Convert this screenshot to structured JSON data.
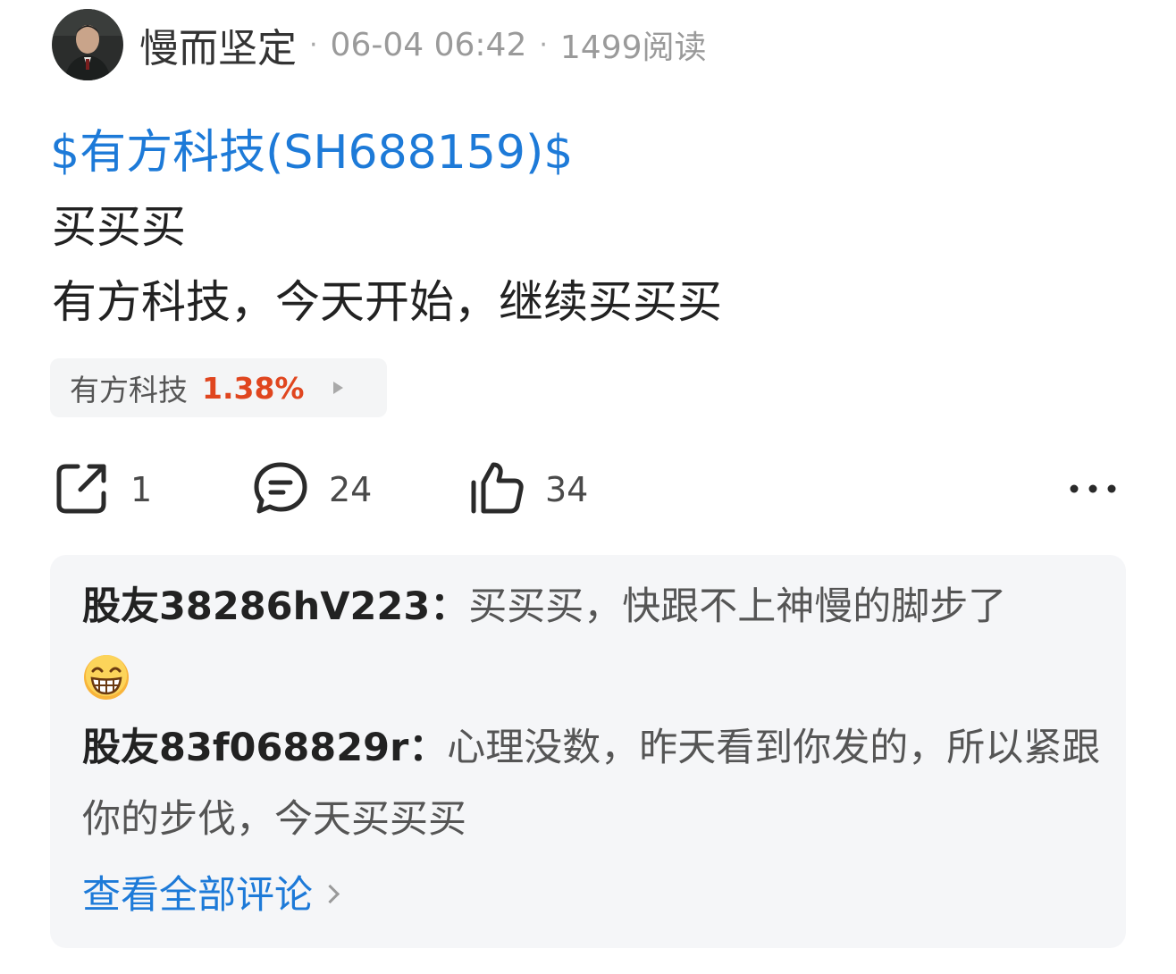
{
  "post": {
    "author": "慢而坚定",
    "separator": "·",
    "datetime": "06-04 06:42",
    "reads": "1499阅读",
    "stock_tag": "$有方科技(SH688159)$",
    "body_lines": [
      "买买买",
      "有方科技，今天开始，继续买买买"
    ]
  },
  "quote": {
    "name": "有方科技",
    "change": "1.38%",
    "change_color": "#e0461f"
  },
  "actions": {
    "share_count": "1",
    "comment_count": "24",
    "like_count": "34",
    "share_icon": "share-icon",
    "comment_icon": "comment-icon",
    "like_icon": "thumbs-up-icon",
    "more_icon": "more-dots-icon"
  },
  "comments": [
    {
      "user": "股友38286hV223",
      "colon": "：",
      "text": "买买买，快跟不上神慢的脚步了",
      "emoji": "grinning-face-emoji"
    },
    {
      "user": "股友83f068829r",
      "colon": "：",
      "text": "心理没数，昨天看到你发的，所以紧跟你的步伐，今天买买买"
    }
  ],
  "view_all": "查看全部评论",
  "colors": {
    "link_blue": "#1d7ad8",
    "up_red": "#e0461f",
    "comment_bg": "#f5f6f8"
  }
}
